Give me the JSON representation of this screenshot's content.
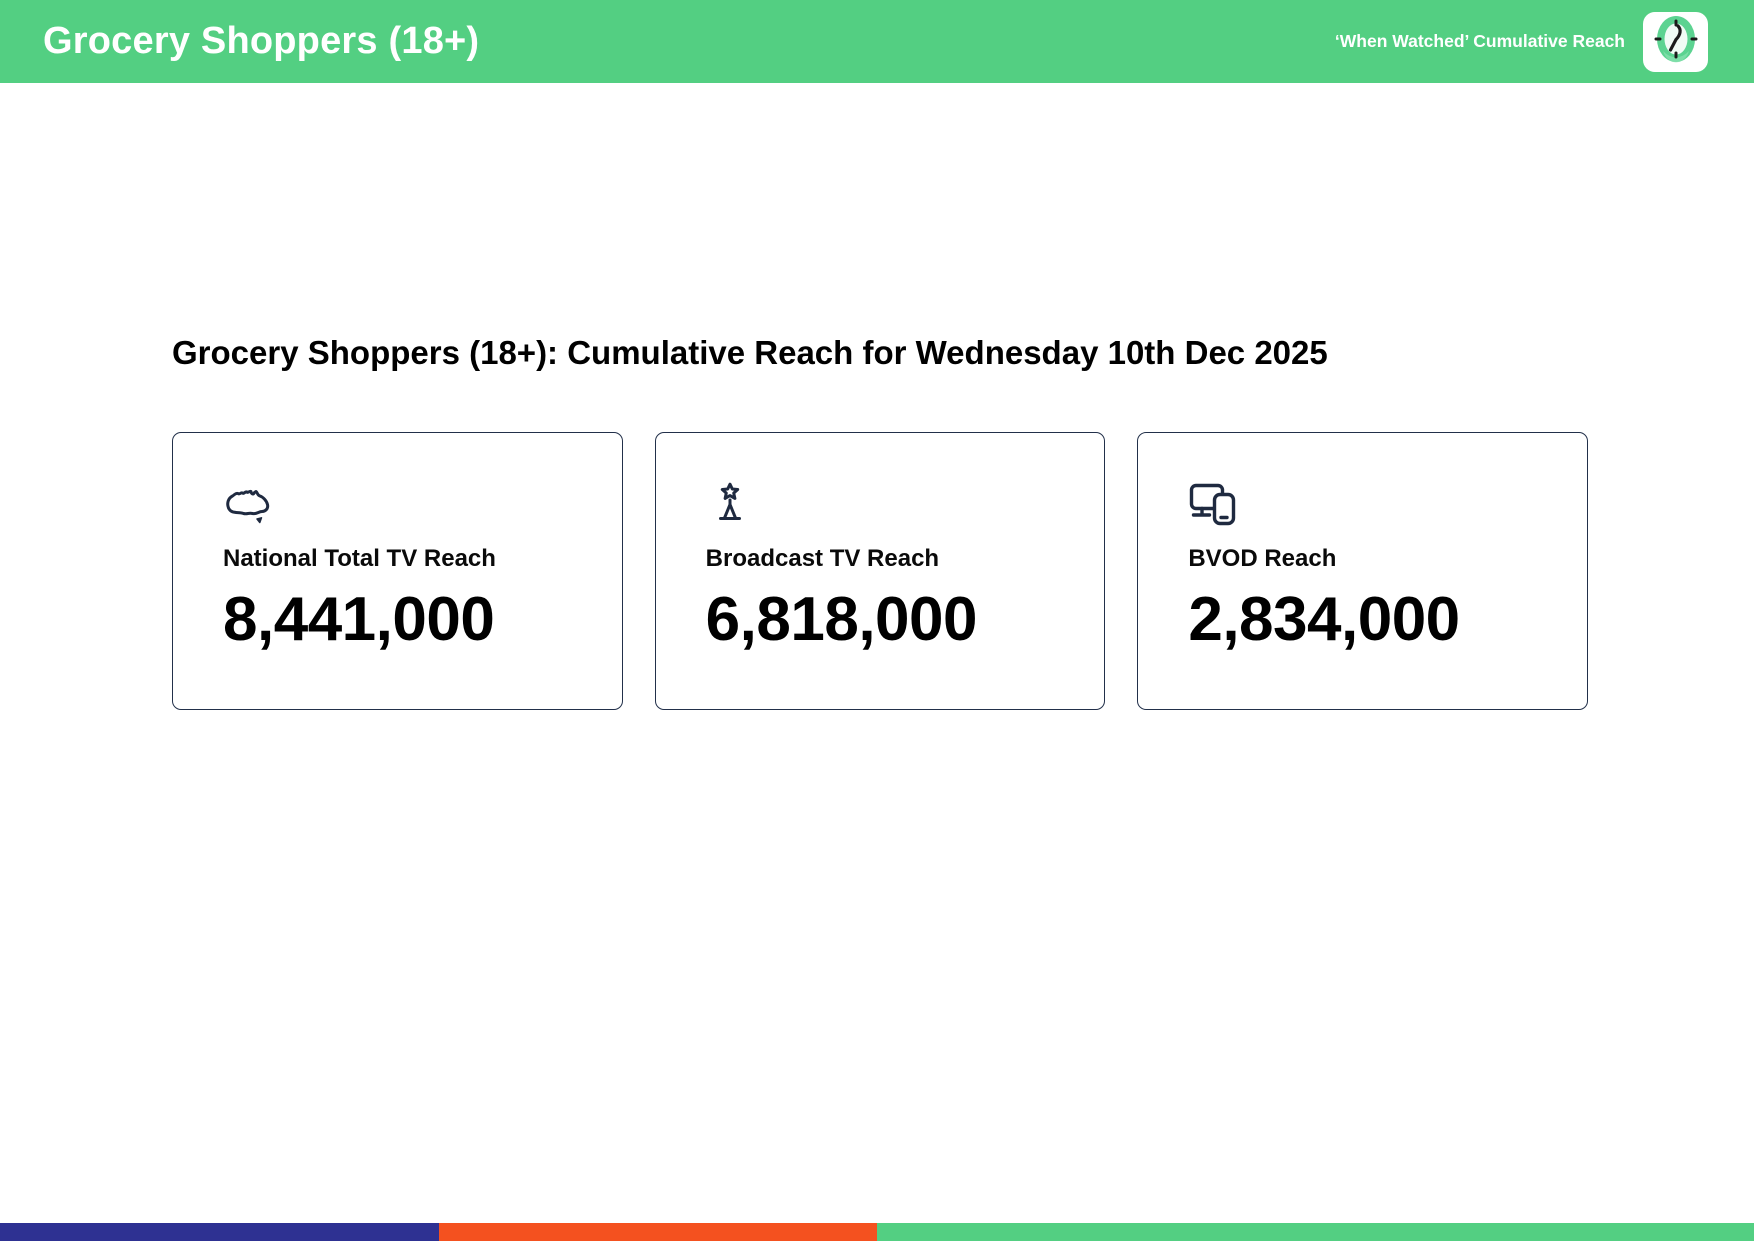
{
  "header": {
    "title": "Grocery Shoppers (18+)",
    "subtitle": "‘When Watched’ Cumulative Reach",
    "app_icon": "clock-icon"
  },
  "main": {
    "heading": "Grocery Shoppers (18+): Cumulative Reach for Wednesday 10th Dec 2025",
    "cards": [
      {
        "icon": "australia-map-icon",
        "label": "National Total TV Reach",
        "value": "8,441,000"
      },
      {
        "icon": "broadcast-tower-icon",
        "label": "Broadcast TV Reach",
        "value": "6,818,000"
      },
      {
        "icon": "devices-icon",
        "label": "BVOD Reach",
        "value": "2,834,000"
      }
    ]
  },
  "footer": {
    "segments": [
      {
        "name": "blue-segment",
        "color": "#2E3192",
        "width_pct": 25
      },
      {
        "name": "orange-segment",
        "color": "#F4511F",
        "width_pct": 25
      },
      {
        "name": "green-segment",
        "color": "#53CF82",
        "width_pct": 50
      }
    ]
  },
  "colors": {
    "brand_green": "#53CF82",
    "navy": "#22304A",
    "icon_navy": "#1F2A40"
  }
}
